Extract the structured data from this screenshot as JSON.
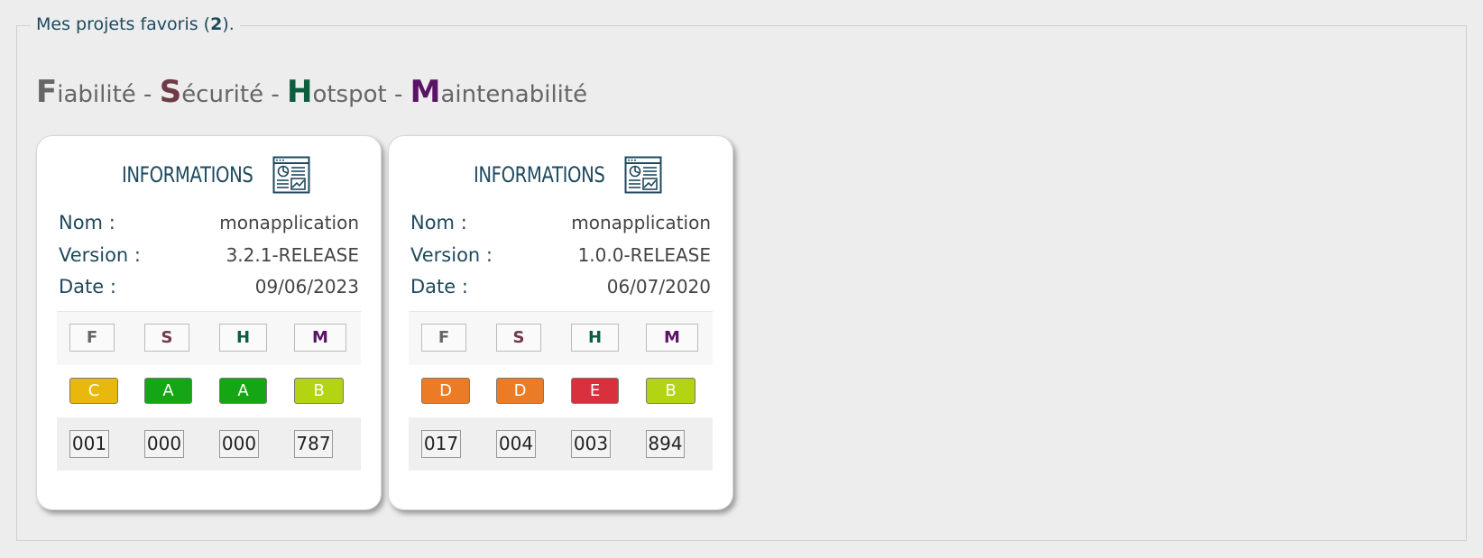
{
  "header": {
    "legend_text": "Mes projets favoris (",
    "favorite_count": "2",
    "legend_suffix": ")."
  },
  "metrics_legend": [
    {
      "initial": "F",
      "rest": "iabilité"
    },
    {
      "initial": "S",
      "rest": "écurité"
    },
    {
      "initial": "H",
      "rest": "otspot"
    },
    {
      "initial": "M",
      "rest": "aintenabilité"
    }
  ],
  "separator": " - ",
  "colors": {
    "F": "#666666",
    "S": "#6e3b47",
    "H": "#0d5e3d",
    "M": "#5a1466",
    "rating_A": "#15a615",
    "rating_B": "#b3d412",
    "rating_C": "#e8b90c",
    "rating_D": "#ec7b25",
    "rating_E": "#d9303e"
  },
  "cards": [
    {
      "title": "INFORMATIONS",
      "icon": "dashboard-document-icon",
      "name_label": "Nom :",
      "name": "monapplication",
      "version_label": "Version :",
      "version": "3.2.1-RELEASE",
      "date_label": "Date :",
      "date": "09/06/2023",
      "headers": [
        "F",
        "S",
        "H",
        "M"
      ],
      "ratings": [
        "C",
        "A",
        "A",
        "B"
      ],
      "counts": [
        "001",
        "000",
        "000",
        "787"
      ]
    },
    {
      "title": "INFORMATIONS",
      "icon": "dashboard-document-icon",
      "name_label": "Nom :",
      "name": "monapplication",
      "version_label": "Version :",
      "version": "1.0.0-RELEASE",
      "date_label": "Date :",
      "date": "06/07/2020",
      "headers": [
        "F",
        "S",
        "H",
        "M"
      ],
      "ratings": [
        "D",
        "D",
        "E",
        "B"
      ],
      "counts": [
        "017",
        "004",
        "003",
        "894"
      ]
    }
  ]
}
